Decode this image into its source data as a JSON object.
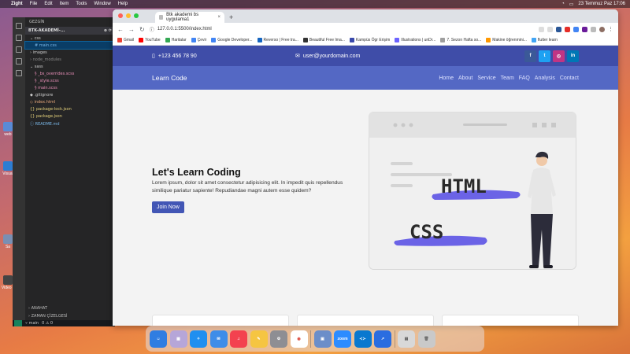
{
  "menubar": {
    "app": "Zight",
    "items": [
      "File",
      "Edit",
      "Item",
      "Tools",
      "Window",
      "Help"
    ],
    "clock": "23 Temmuz Paz  17:06"
  },
  "desktop": {
    "labels": [
      "web",
      "Visual",
      "Sa",
      "Video ll"
    ]
  },
  "vscode": {
    "explorer_title": "GEZGİN",
    "project": "BTK-AKADEMİ-...",
    "files": [
      {
        "name": "css",
        "kind": "folder"
      },
      {
        "name": "main.css",
        "kind": "css"
      },
      {
        "name": "images",
        "kind": "folder"
      },
      {
        "name": "node_modules",
        "kind": "folder"
      },
      {
        "name": "sass",
        "kind": "folder"
      },
      {
        "name": "_bs_overrides.scss",
        "kind": "scss"
      },
      {
        "name": "_style.scss",
        "kind": "scss"
      },
      {
        "name": "main.scss",
        "kind": "scss"
      },
      {
        "name": ".gitignore",
        "kind": "git"
      },
      {
        "name": "index.html",
        "kind": "html"
      },
      {
        "name": "package-lock.json",
        "kind": "json"
      },
      {
        "name": "package.json",
        "kind": "json"
      },
      {
        "name": "README.md",
        "kind": "md"
      }
    ],
    "outline": "ANAHAT",
    "timeline": "ZAMAN ÇİZELGESİ",
    "branch": "main",
    "problems": "0 ⚠ 0"
  },
  "browser": {
    "tab_title": "Btk akademi bs uygulama1",
    "new_tab": "+",
    "url": "127.0.0.1:5500/index.html",
    "bookmarks": [
      {
        "label": "Gmail",
        "color": "#ea4335"
      },
      {
        "label": "YouTube",
        "color": "#ff0000"
      },
      {
        "label": "Haritalar",
        "color": "#34a853"
      },
      {
        "label": "Çevir",
        "color": "#4285f4"
      },
      {
        "label": "Google Developer...",
        "color": "#4285f4"
      },
      {
        "label": "Reverso | Free tra...",
        "color": "#1565c0"
      },
      {
        "label": "Beautiful Free Ima...",
        "color": "#333333"
      },
      {
        "label": "Kampüs Ögr Erişim",
        "color": "#3949ab"
      },
      {
        "label": "Illustrations | unDr...",
        "color": "#6c63ff"
      },
      {
        "label": "7. Sezon Hafta so...",
        "color": "#9e9e9e"
      },
      {
        "label": "Makine öğrenmini...",
        "color": "#ff9800"
      },
      {
        "label": "flutter learn",
        "color": "#42a5f5"
      }
    ]
  },
  "site": {
    "phone": "+123 456 78 90",
    "email": "user@yourdomain.com",
    "social": [
      {
        "icon": "facebook-icon",
        "glyph": "f",
        "color": "#3b5998"
      },
      {
        "icon": "twitter-icon",
        "glyph": "t",
        "color": "#1da1f2"
      },
      {
        "icon": "instagram-icon",
        "glyph": "◎",
        "color": "#c13584"
      },
      {
        "icon": "linkedin-icon",
        "glyph": "in",
        "color": "#0077b5"
      }
    ],
    "brand": "Learn Code",
    "nav": [
      "Home",
      "About",
      "Service",
      "Team",
      "FAQ",
      "Analysis",
      "Contact"
    ],
    "hero": {
      "title": "Let's Learn Coding",
      "text": "Lorem ipsum, dolor sit amet consectetur adipisicing elit. In impedit quis repellendus similique pariatur sapiente! Repudiandae magni autem esse quidem?",
      "button": "Join Now",
      "illus_html": "HTML",
      "illus_css": "CSS"
    },
    "colors": {
      "topbar": "#3f4da8",
      "navbar": "#5468c4",
      "accent": "#4256b5"
    }
  },
  "dock": [
    "Finder",
    "Launchpad",
    "Safari",
    "Mail",
    "Music",
    "Notes",
    "Settings",
    "Chrome",
    "Preview",
    "Zoom",
    "VS Code",
    "Zight",
    "Downloads",
    "Trash"
  ]
}
